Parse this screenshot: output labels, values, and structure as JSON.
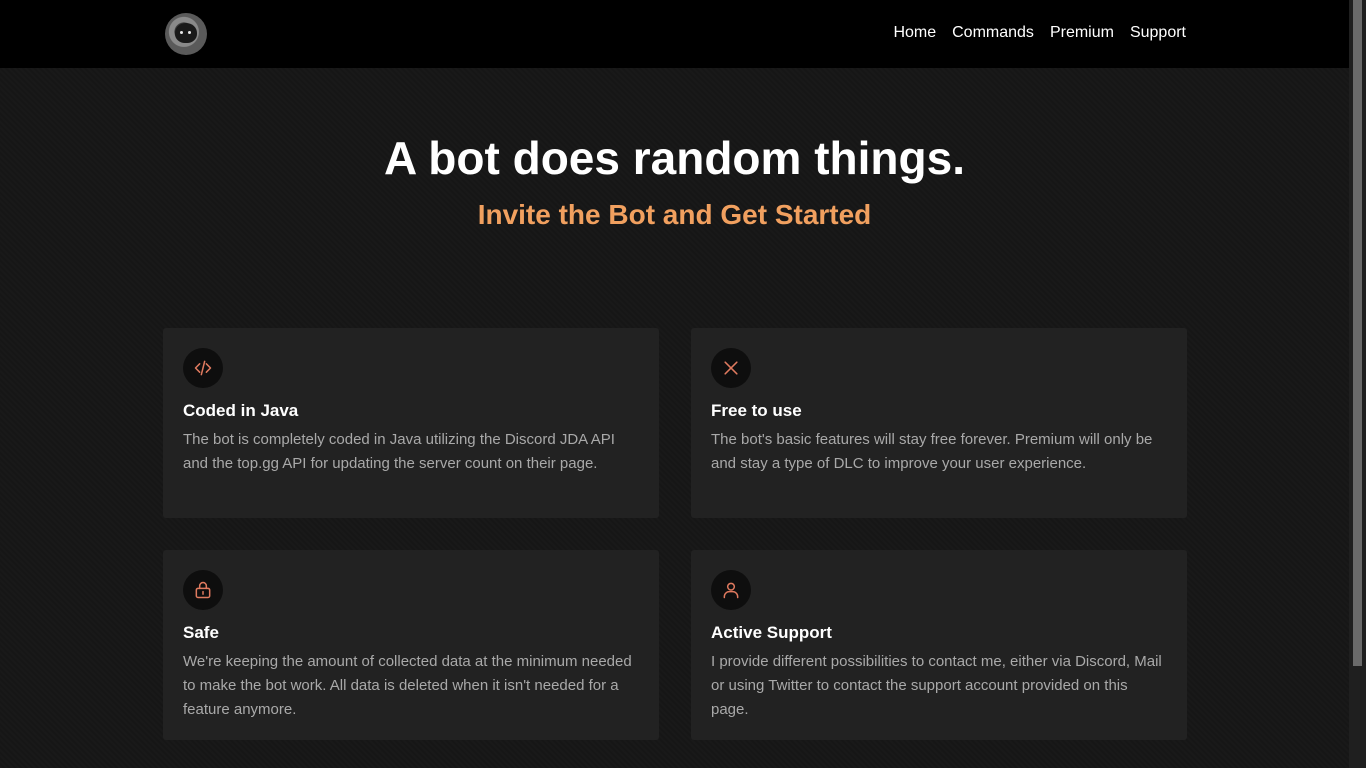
{
  "nav": {
    "links": [
      "Home",
      "Commands",
      "Premium",
      "Support"
    ]
  },
  "hero": {
    "title": "A bot does random things.",
    "subtitle": "Invite the Bot and Get Started"
  },
  "features": [
    {
      "icon": "code-icon",
      "title": "Coded in Java",
      "text": "The bot is completely coded in Java utilizing the Discord JDA API and the top.gg API for updating the server count on their page."
    },
    {
      "icon": "x-icon",
      "title": "Free to use",
      "text": "The bot's basic features will stay free forever. Premium will only be and stay a type of DLC to improve your user experience."
    },
    {
      "icon": "lock-icon",
      "title": "Safe",
      "text": "We're keeping the amount of collected data at the minimum needed to make the bot work. All data is deleted when it isn't needed for a feature anymore."
    },
    {
      "icon": "user-icon",
      "title": "Active Support",
      "text": "I provide different possibilities to contact me, either via Discord, Mail or using Twitter to contact the support account provided on this page."
    }
  ],
  "colors": {
    "accent": "#f1a05f",
    "icon": "#e07a5f",
    "background": "#161616",
    "card": "#222222",
    "navbar": "#000000"
  }
}
